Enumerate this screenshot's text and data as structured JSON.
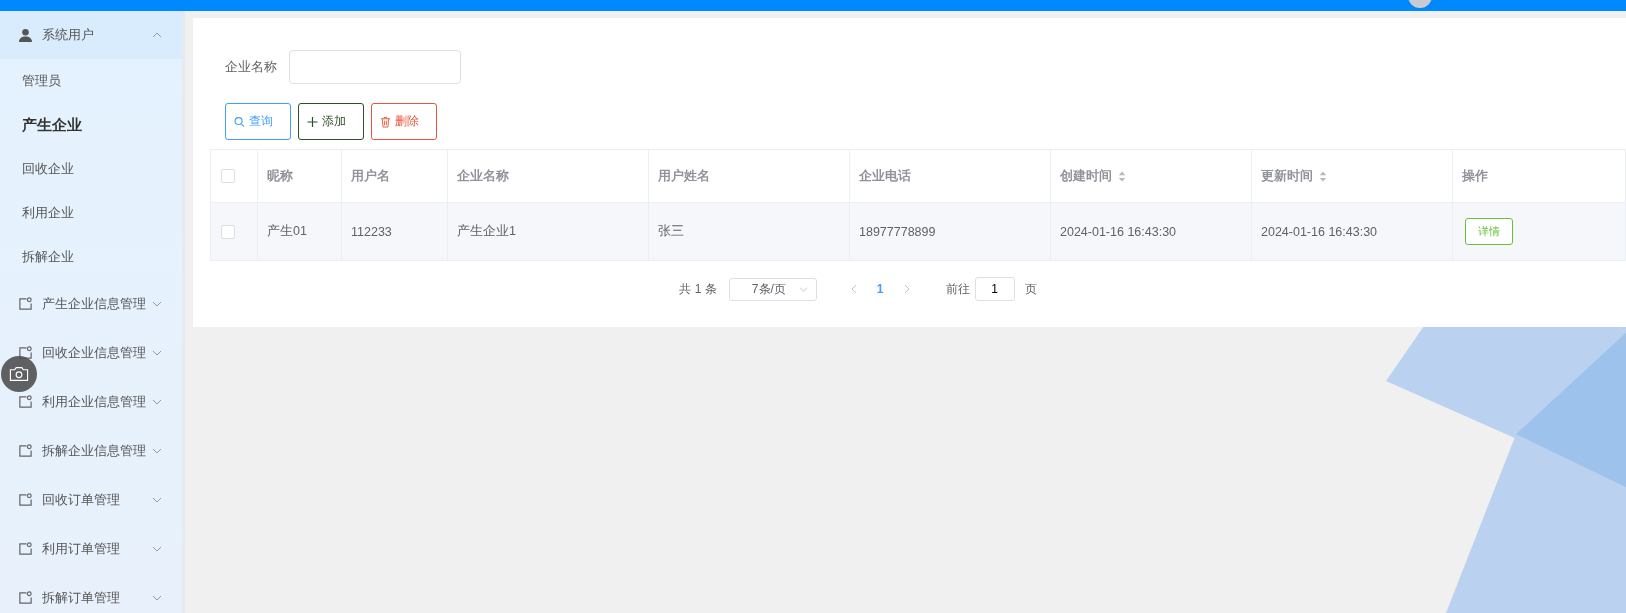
{
  "sidebar": {
    "menus": [
      {
        "label": "系统用户",
        "kind": "user",
        "expanded": true,
        "children": [
          {
            "label": "管理员",
            "selected": false
          },
          {
            "label": "产生企业",
            "selected": true
          },
          {
            "label": "回收企业",
            "selected": false
          },
          {
            "label": "利用企业",
            "selected": false
          },
          {
            "label": "拆解企业",
            "selected": false
          }
        ]
      },
      {
        "label": "产生企业信息管理",
        "kind": "folder",
        "expanded": false
      },
      {
        "label": "回收企业信息管理",
        "kind": "folder",
        "expanded": false
      },
      {
        "label": "利用企业信息管理",
        "kind": "folder",
        "expanded": false
      },
      {
        "label": "拆解企业信息管理",
        "kind": "folder",
        "expanded": false
      },
      {
        "label": "回收订单管理",
        "kind": "folder",
        "expanded": false
      },
      {
        "label": "利用订单管理",
        "kind": "folder",
        "expanded": false
      },
      {
        "label": "拆解订单管理",
        "kind": "folder",
        "expanded": false
      }
    ]
  },
  "search": {
    "label": "企业名称"
  },
  "buttons": [
    {
      "label": "查询",
      "kind": "search"
    },
    {
      "label": "添加",
      "kind": "add"
    },
    {
      "label": "删除",
      "kind": "delete"
    }
  ],
  "table": {
    "header_checked": false,
    "columns": [
      {
        "label": "昵称",
        "sortable": false
      },
      {
        "label": "用户名",
        "sortable": false
      },
      {
        "label": "企业名称",
        "sortable": false
      },
      {
        "label": "用户姓名",
        "sortable": false
      },
      {
        "label": "企业电话",
        "sortable": false
      },
      {
        "label": "创建时间",
        "sortable": true
      },
      {
        "label": "更新时间",
        "sortable": true
      },
      {
        "label": "操作",
        "sortable": false
      }
    ],
    "rows": [
      {
        "checked": false,
        "cells": [
          "产生01",
          "112233",
          "产生企业1",
          "张三",
          "18977778899",
          "2024-01-16 16:43:30",
          "2024-01-16 16:43:30"
        ],
        "action": "详情"
      }
    ]
  },
  "pagination": {
    "total": "共 1 条",
    "page_size": "7条/页",
    "pages": [
      {
        "label": "1",
        "selected": true
      }
    ],
    "goto_label": "前往",
    "goto_value": "1",
    "page_suffix": "页"
  }
}
